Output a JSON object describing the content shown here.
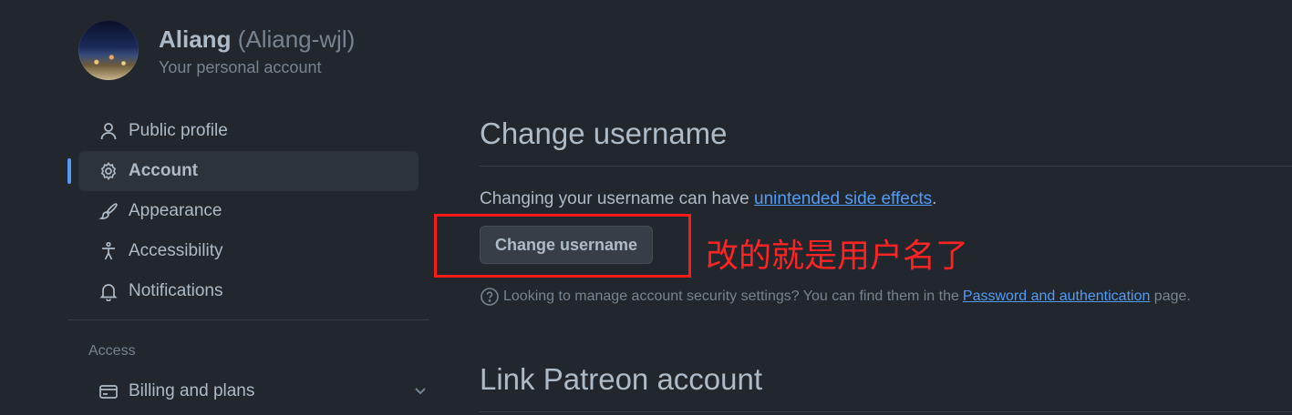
{
  "header": {
    "display_name": "Aliang",
    "login": "(Aliang-wjl)",
    "subtitle": "Your personal account"
  },
  "sidebar": {
    "items": [
      {
        "label": "Public profile",
        "icon": "person-icon"
      },
      {
        "label": "Account",
        "icon": "gear-icon",
        "active": true
      },
      {
        "label": "Appearance",
        "icon": "paintbrush-icon"
      },
      {
        "label": "Accessibility",
        "icon": "accessibility-icon"
      },
      {
        "label": "Notifications",
        "icon": "bell-icon"
      }
    ],
    "section_heading": "Access",
    "billing": {
      "label": "Billing and plans",
      "icon": "credit-card-icon"
    }
  },
  "main": {
    "change_username": {
      "title": "Change username",
      "desc_prefix": "Changing your username can have ",
      "desc_link": "unintended side effects",
      "desc_suffix": ".",
      "button_label": "Change username",
      "note_prefix": "Looking to manage account security settings? You can find them in the ",
      "note_link": "Password and authentication",
      "note_suffix": " page."
    },
    "patreon": {
      "title": "Link Patreon account"
    }
  },
  "annotation": {
    "text": "改的就是用户名了",
    "color": "#ff2323"
  },
  "colors": {
    "background": "#22272e",
    "accent": "#539bf5",
    "text": "#adbac7",
    "muted": "#768390"
  }
}
